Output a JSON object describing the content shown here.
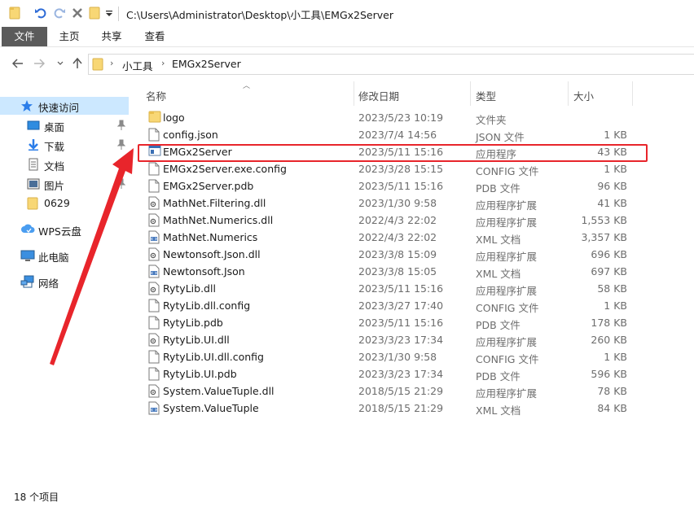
{
  "window": {
    "title": "C:\\Users\\Administrator\\Desktop\\小工具\\EMGx2Server"
  },
  "ribbon": {
    "tabs": [
      "文件",
      "主页",
      "共享",
      "查看"
    ]
  },
  "address": {
    "crumbs": [
      "小工具",
      "EMGx2Server"
    ]
  },
  "nav": {
    "quick_access": "快速访问",
    "items": [
      {
        "label": "桌面",
        "icon": "desktop-icon",
        "pinned": true
      },
      {
        "label": "下载",
        "icon": "download-icon",
        "pinned": true
      },
      {
        "label": "文档",
        "icon": "documents-icon",
        "pinned": true
      },
      {
        "label": "图片",
        "icon": "pictures-icon",
        "pinned": true
      },
      {
        "label": "0629",
        "icon": "folder-icon",
        "pinned": false
      }
    ],
    "wps": "WPS云盘",
    "this_pc": "此电脑",
    "network": "网络"
  },
  "columns": {
    "name": "名称",
    "date": "修改日期",
    "type": "类型",
    "size": "大小"
  },
  "files": [
    {
      "name": "logo",
      "date": "2023/5/23 10:19",
      "type": "文件夹",
      "size": "",
      "icon": "folder-icon"
    },
    {
      "name": "config.json",
      "date": "2023/7/4 14:56",
      "type": "JSON 文件",
      "size": "1 KB",
      "icon": "file-icon"
    },
    {
      "name": "EMGx2Server",
      "date": "2023/5/11 15:16",
      "type": "应用程序",
      "size": "43 KB",
      "icon": "application-icon"
    },
    {
      "name": "EMGx2Server.exe.config",
      "date": "2023/3/28 15:15",
      "type": "CONFIG 文件",
      "size": "1 KB",
      "icon": "file-icon"
    },
    {
      "name": "EMGx2Server.pdb",
      "date": "2023/5/11 15:16",
      "type": "PDB 文件",
      "size": "96 KB",
      "icon": "file-icon"
    },
    {
      "name": "MathNet.Filtering.dll",
      "date": "2023/1/30 9:58",
      "type": "应用程序扩展",
      "size": "41 KB",
      "icon": "dll-icon"
    },
    {
      "name": "MathNet.Numerics.dll",
      "date": "2022/4/3 22:02",
      "type": "应用程序扩展",
      "size": "1,553 KB",
      "icon": "dll-icon"
    },
    {
      "name": "MathNet.Numerics",
      "date": "2022/4/3 22:02",
      "type": "XML 文档",
      "size": "3,357 KB",
      "icon": "xml-icon"
    },
    {
      "name": "Newtonsoft.Json.dll",
      "date": "2023/3/8 15:09",
      "type": "应用程序扩展",
      "size": "696 KB",
      "icon": "dll-icon"
    },
    {
      "name": "Newtonsoft.Json",
      "date": "2023/3/8 15:05",
      "type": "XML 文档",
      "size": "697 KB",
      "icon": "xml-icon"
    },
    {
      "name": "RytyLib.dll",
      "date": "2023/5/11 15:16",
      "type": "应用程序扩展",
      "size": "58 KB",
      "icon": "dll-icon"
    },
    {
      "name": "RytyLib.dll.config",
      "date": "2023/3/27 17:40",
      "type": "CONFIG 文件",
      "size": "1 KB",
      "icon": "file-icon"
    },
    {
      "name": "RytyLib.pdb",
      "date": "2023/5/11 15:16",
      "type": "PDB 文件",
      "size": "178 KB",
      "icon": "file-icon"
    },
    {
      "name": "RytyLib.UI.dll",
      "date": "2023/3/23 17:34",
      "type": "应用程序扩展",
      "size": "260 KB",
      "icon": "dll-icon"
    },
    {
      "name": "RytyLib.UI.dll.config",
      "date": "2023/1/30 9:58",
      "type": "CONFIG 文件",
      "size": "1 KB",
      "icon": "file-icon"
    },
    {
      "name": "RytyLib.UI.pdb",
      "date": "2023/3/23 17:34",
      "type": "PDB 文件",
      "size": "596 KB",
      "icon": "file-icon"
    },
    {
      "name": "System.ValueTuple.dll",
      "date": "2018/5/15 21:29",
      "type": "应用程序扩展",
      "size": "78 KB",
      "icon": "dll-icon"
    },
    {
      "name": "System.ValueTuple",
      "date": "2018/5/15 21:29",
      "type": "XML 文档",
      "size": "84 KB",
      "icon": "xml-icon"
    }
  ],
  "status": {
    "count": "18 个项目"
  },
  "colors": {
    "highlight": "#e8252b",
    "selection": "#cce8ff",
    "folder": "#f8d775",
    "file_tab": "#5b5b5b"
  }
}
